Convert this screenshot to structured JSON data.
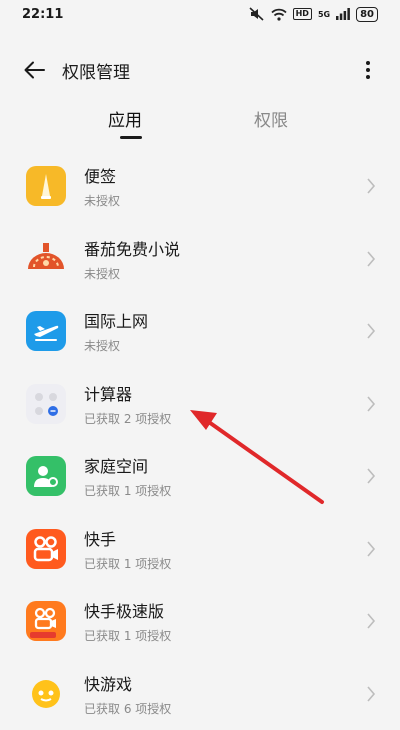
{
  "status_bar": {
    "time": "22:11",
    "network_label": "5G",
    "hd_label": "HD",
    "battery": "80"
  },
  "header": {
    "title": "权限管理",
    "back_icon": "arrow-left-icon",
    "more_icon": "more-vertical-icon"
  },
  "tabs": [
    {
      "label": "应用",
      "active": true
    },
    {
      "label": "权限",
      "active": false
    }
  ],
  "apps": [
    {
      "name": "便签",
      "status": "未授权",
      "icon": "notes-app-icon",
      "color": "#f7b928"
    },
    {
      "name": "番茄免费小说",
      "status": "未授权",
      "icon": "tomato-novel-app-icon",
      "color": "#e2542a"
    },
    {
      "name": "国际上网",
      "status": "未授权",
      "icon": "airplane-app-icon",
      "color": "#1e9be9"
    },
    {
      "name": "计算器",
      "status": "已获取 2 项授权",
      "icon": "calculator-app-icon",
      "color": "#eeeef3"
    },
    {
      "name": "家庭空间",
      "status": "已获取 1 项授权",
      "icon": "family-space-app-icon",
      "color": "#34c068"
    },
    {
      "name": "快手",
      "status": "已获取 1 项授权",
      "icon": "kuaishou-app-icon",
      "color": "#ff5a1e"
    },
    {
      "name": "快手极速版",
      "status": "已获取 1 项授权",
      "icon": "kuaishou-lite-app-icon",
      "color": "#ff7a1e"
    },
    {
      "name": "快游戏",
      "status": "已获取 6 项授权",
      "icon": "quick-game-app-icon",
      "color": "#ffc21a"
    }
  ]
}
